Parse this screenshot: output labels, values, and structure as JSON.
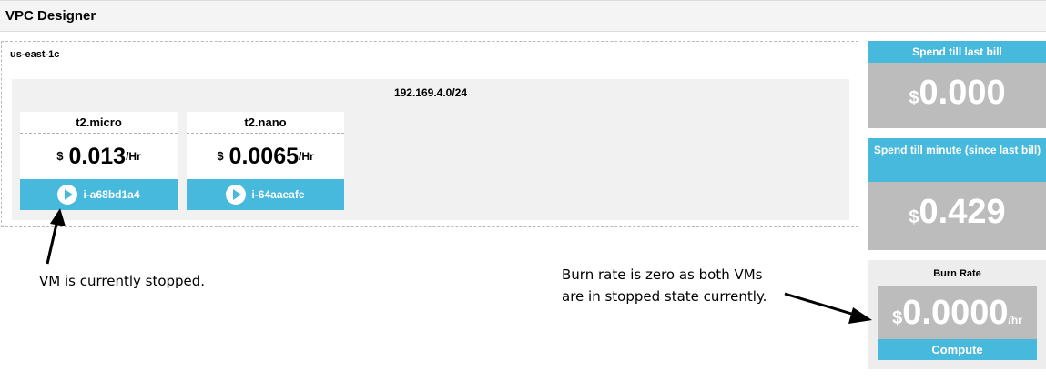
{
  "app": {
    "title": "VPC Designer"
  },
  "zone": {
    "label": "us-east-1c",
    "subnet": {
      "cidr": "192.169.4.0/24",
      "instances": [
        {
          "type": "t2.micro",
          "currency": "$",
          "price": "0.013",
          "unit": "/Hr",
          "id": "i-a68bd1a4",
          "icon": "play-icon"
        },
        {
          "type": "t2.nano",
          "currency": "$",
          "price": "0.0065",
          "unit": "/Hr",
          "id": "i-64aaeafe",
          "icon": "play-icon"
        }
      ]
    }
  },
  "panels": {
    "spend_last_bill": {
      "title": "Spend till last bill",
      "currency": "$",
      "value": "0.000"
    },
    "spend_till_minute": {
      "title": "Spend till minute (since last bill)",
      "currency": "$",
      "value": "0.429"
    },
    "burn_rate": {
      "title": "Burn Rate",
      "currency": "$",
      "value": "0.0000",
      "unit": "/hr",
      "button": "Compute"
    }
  },
  "annotations": {
    "vm_note": "VM is currently stopped.",
    "burn_note_line1": "Burn rate is zero as both VMs",
    "burn_note_line2": "are in stopped state currently."
  },
  "colors": {
    "accent": "#47b9dc",
    "panel_gray": "#bcbcbc"
  }
}
